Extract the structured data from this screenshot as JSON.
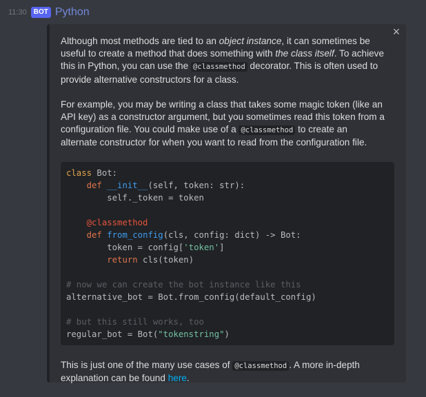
{
  "header": {
    "timestamp": "11:30",
    "bot_tag": "BOT",
    "author": "Python"
  },
  "embed": {
    "close_icon": "×",
    "p1": {
      "t1": "Although most methods are tied to an ",
      "em1": "object instance",
      "t2": ", it can sometimes be useful to create a method that does something with ",
      "em2": "the class itself",
      "t3": ". To achieve this in Python, you can use the ",
      "code": "@classmethod",
      "t4": " decorator. This is often used to provide alternative constructors for a class."
    },
    "p2": {
      "t1": "For example, you may be writing a class that takes some magic token (like an API key) as a constructor argument, but you sometimes read this token from a configuration file. You could make use of a ",
      "code": "@classmethod",
      "t2": " to create an alternate constructor for when you want to read from the configuration file."
    },
    "code": {
      "l1_kw": "class",
      "l1_rest": " Bot:",
      "l2_indent": "    ",
      "l2_kw": "def",
      "l2_fn": "__init__",
      "l2_rest": "(self, token: str):",
      "l3": "        self._token = token",
      "l4": "",
      "l5_indent": "    ",
      "l5_dec": "@classmethod",
      "l6_indent": "    ",
      "l6_kw": "def",
      "l6_fn": "from_config",
      "l6_rest": "(cls, config: dict) -> Bot:",
      "l7_a": "        token = config[",
      "l7_str": "'token'",
      "l7_b": "]",
      "l8_indent": "        ",
      "l8_kw": "return",
      "l8_rest": " cls(token)",
      "l9": "",
      "l10": "# now we can create the bot instance like this",
      "l11": "alternative_bot = Bot.from_config(default_config)",
      "l12": "",
      "l13": "# but this still works, too",
      "l14_a": "regular_bot = Bot(",
      "l14_str": "\"tokenstring\"",
      "l14_b": ")"
    },
    "p3": {
      "t1": "This is just one of the many use cases of ",
      "code": "@classmethod",
      "t2": ". A more in-depth explanation can be found ",
      "link": "here",
      "t3": "."
    }
  }
}
